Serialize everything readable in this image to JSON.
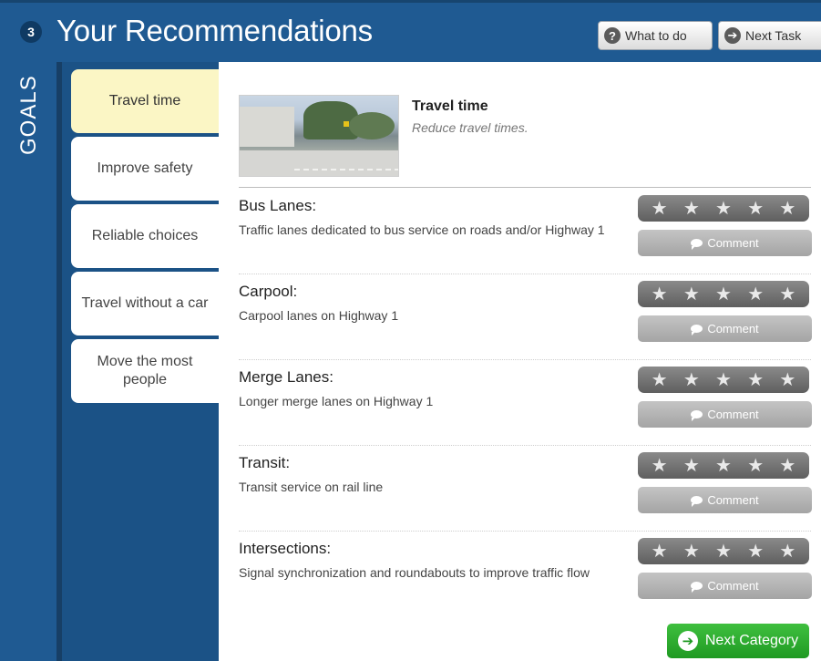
{
  "header": {
    "step_number": "3",
    "title": "Your Recommendations",
    "what_to_do_label": "What to do",
    "next_task_label": "Next Task"
  },
  "rail": {
    "label": "GOALS"
  },
  "goals": [
    {
      "label": "Travel time",
      "active": true
    },
    {
      "label": "Improve safety",
      "active": false
    },
    {
      "label": "Reliable choices",
      "active": false
    },
    {
      "label": "Travel without a car",
      "active": false
    },
    {
      "label": "Move the most people",
      "active": false
    }
  ],
  "goal_detail": {
    "name": "Travel time",
    "description": "Reduce travel times."
  },
  "recommendations": [
    {
      "name": "Bus Lanes:",
      "description": "Traffic lanes dedicated to bus service on roads and/or Highway 1",
      "comment_label": "Comment"
    },
    {
      "name": "Carpool:",
      "description": "Carpool lanes on Highway 1",
      "comment_label": "Comment"
    },
    {
      "name": "Merge Lanes:",
      "description": "Longer merge lanes on Highway 1",
      "comment_label": "Comment"
    },
    {
      "name": "Transit:",
      "description": "Transit service on rail line",
      "comment_label": "Comment"
    },
    {
      "name": "Intersections:",
      "description": "Signal synchronization and roundabouts to improve traffic flow",
      "comment_label": "Comment"
    }
  ],
  "rating": {
    "max_stars": 5,
    "star_glyph": "★"
  },
  "footer": {
    "next_category_label": "Next Category"
  },
  "icons": {
    "help": "question-icon",
    "next": "arrow-right-icon",
    "comment": "speech-bubble-icon"
  },
  "colors": {
    "header_blue": "#1f5a92",
    "active_tab": "#fbf6c5",
    "next_green": "#2aa82d"
  }
}
